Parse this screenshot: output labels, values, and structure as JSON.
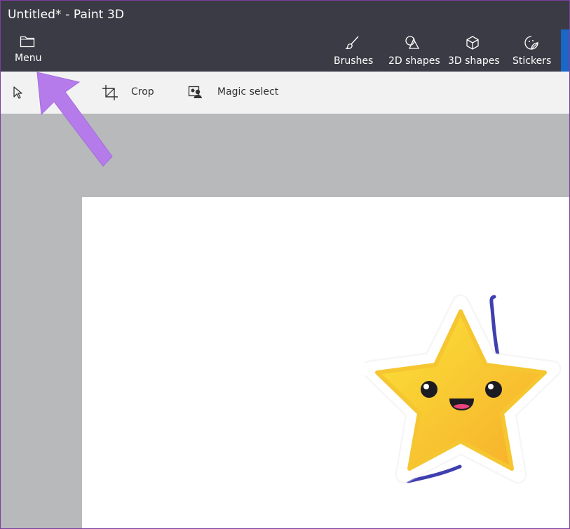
{
  "window": {
    "title": "Untitled* - Paint 3D"
  },
  "ribbon": {
    "menu_label": "Menu",
    "tools": [
      {
        "label": "Brushes",
        "icon": "brush-icon"
      },
      {
        "label": "2D shapes",
        "icon": "2d-shapes-icon"
      },
      {
        "label": "3D shapes",
        "icon": "3d-shapes-icon"
      },
      {
        "label": "Stickers",
        "icon": "stickers-icon"
      }
    ]
  },
  "toolbar": {
    "crop_label": "Crop",
    "magic_select_label": "Magic select"
  },
  "canvas": {
    "sticker": "star-sticker"
  },
  "annotation": {
    "icon": "pointer-arrow",
    "color": "#b57bea"
  },
  "colors": {
    "ribbon_bg": "#3a3b44",
    "accent": "#1a67c8",
    "toolbar_bg": "#f2f2f2",
    "workspace_bg": "#b7b9ba",
    "star_fill": "#f8cf2c"
  }
}
